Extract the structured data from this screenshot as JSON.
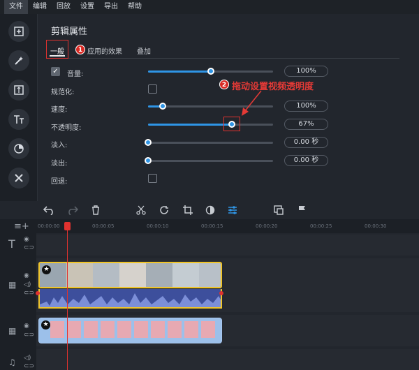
{
  "menu": [
    "文件",
    "编辑",
    "回放",
    "设置",
    "导出",
    "帮助"
  ],
  "panel_title": "剪辑属性",
  "tabs": [
    "一般",
    "应用的效果",
    "叠加"
  ],
  "badges": {
    "one": "1",
    "two": "2"
  },
  "annotation": "拖动设置视频透明度",
  "properties": {
    "volume": {
      "label": "音量:",
      "value": "100%",
      "level": 0.5
    },
    "normalize": {
      "label": "规范化:"
    },
    "speed": {
      "label": "速度:",
      "value": "100%",
      "level": 0.12
    },
    "opacity": {
      "label": "不透明度:",
      "value": "67%",
      "level": 0.67
    },
    "fade_in": {
      "label": "淡入:",
      "value": "0.00 秒",
      "level": 0.0
    },
    "fade_out": {
      "label": "淡出:",
      "value": "0.00 秒",
      "level": 0.0
    },
    "reverse": {
      "label": "回退:"
    }
  },
  "ruler_ticks": [
    "00:00:00",
    "00:00:05",
    "00:00:10",
    "00:00:15",
    "00:00:20",
    "00:00:25",
    "00:00:30"
  ],
  "clip_badge": "★",
  "colors": {
    "accent": "#2f95e6",
    "highlight": "#e0322f",
    "clip_border": "#f0c52a"
  },
  "icons": {
    "sidebar": [
      "import-icon",
      "magic-wand-icon",
      "transitions-icon",
      "titles-icon",
      "clock-icon",
      "tools-icon"
    ],
    "toolbar": [
      "undo-icon",
      "redo-icon",
      "delete-icon",
      "cut-icon",
      "rotate-icon",
      "crop-icon",
      "color-icon",
      "properties-icon",
      "pip-icon",
      "flag-icon"
    ]
  }
}
